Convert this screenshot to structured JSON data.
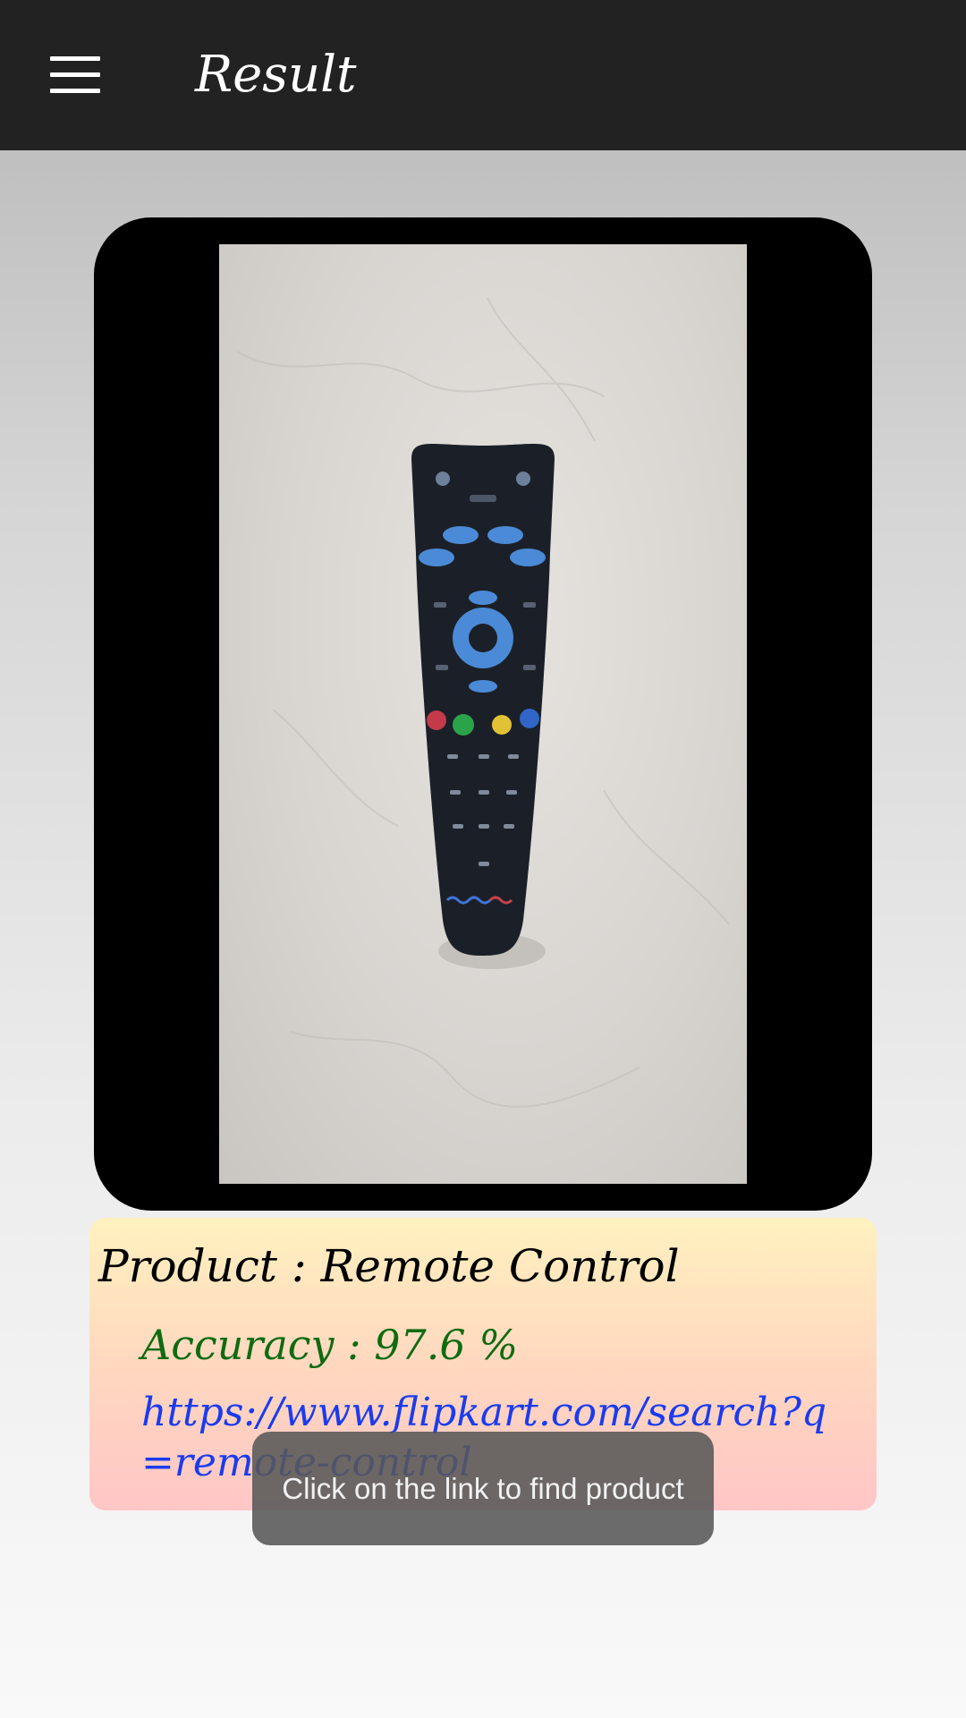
{
  "appbar": {
    "title": "Result",
    "menu_icon": "hamburger-menu-icon",
    "background": "#222222"
  },
  "photo": {
    "description_icon": "remote-control-photo"
  },
  "result": {
    "product": "Product : Remote Control",
    "accuracy": "Accuracy : 97.6 %",
    "link": "https://www.flipkart.com/search?q=remote-control",
    "accuracy_color": "#0f6b12",
    "link_color": "#1a3cf0"
  },
  "toast": {
    "message": "Click on the link to find product"
  }
}
